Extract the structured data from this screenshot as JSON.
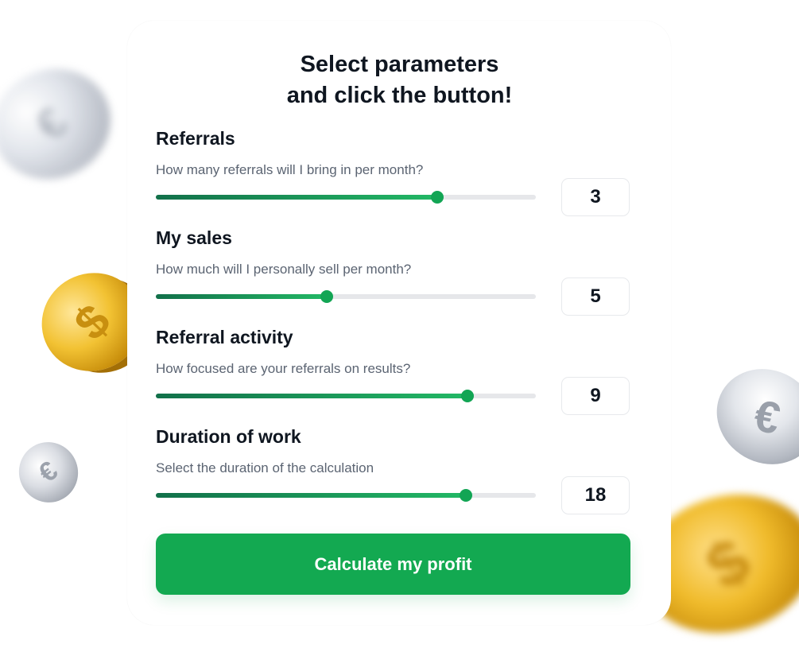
{
  "header": {
    "title_line1": "Select parameters",
    "title_line2": "and click the button!"
  },
  "sliders": [
    {
      "label": "Referrals",
      "description": "How many referrals will I bring in per month?",
      "value": "3",
      "fill_fraction": 0.74
    },
    {
      "label": "My sales",
      "description": "How much will I personally sell per month?",
      "value": "5",
      "fill_fraction": 0.45
    },
    {
      "label": "Referral activity",
      "description": "How focused are your referrals on results?",
      "value": "9",
      "fill_fraction": 0.82
    },
    {
      "label": "Duration of work",
      "description": "Select the duration of the calculation",
      "value": "18",
      "fill_fraction": 0.815
    }
  ],
  "button": {
    "label": "Calculate my profit"
  },
  "colors": {
    "accent": "#13a951",
    "slider_fill_start": "#12704a",
    "slider_fill_end": "#22b865",
    "track": "#e6e7ea"
  },
  "decorations": {
    "coins": [
      "silver-coin-icon",
      "gold-coin-icon",
      "silver-coin-icon",
      "silver-coin-icon",
      "gold-coin-icon"
    ]
  }
}
